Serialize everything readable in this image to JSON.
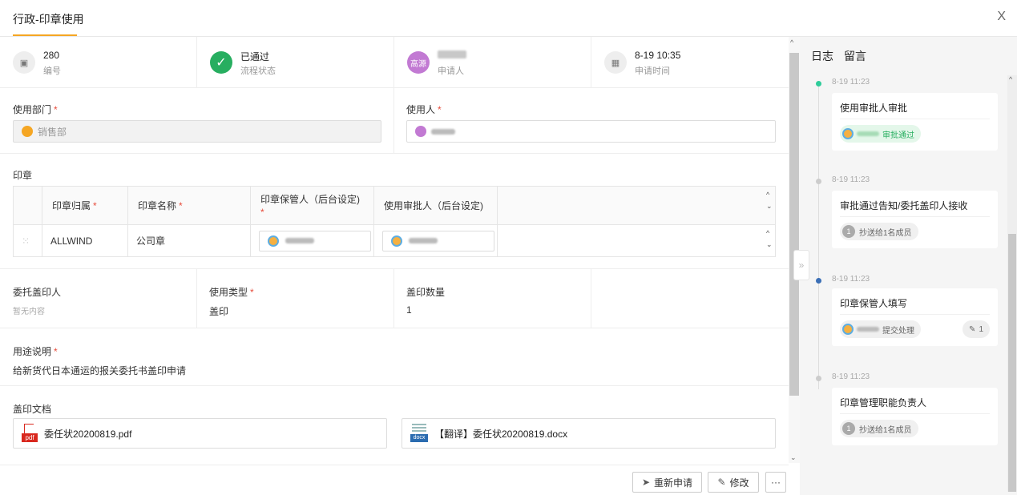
{
  "header": {
    "title": "行政-印章使用",
    "close_glyph": "X"
  },
  "info": {
    "number_value": "280",
    "number_label": "编号",
    "status_value": "已通过",
    "status_label": "流程状态",
    "applicant_avatar": "高源",
    "applicant_label": "申请人",
    "time_value": "8-19 10:35",
    "time_label": "申请时间"
  },
  "form": {
    "dept_label": "使用部门",
    "dept_value": "销售部",
    "user_label": "使用人",
    "seal_section": "印章",
    "seal_table": {
      "headers": [
        "印章归属",
        "印章名称",
        "印章保管人（后台设定)",
        "使用审批人（后台设定)"
      ],
      "row": {
        "owner": "ALLWIND",
        "name": "公司章"
      }
    },
    "delegate_label": "委托盖印人",
    "delegate_value": "暂无内容",
    "use_type_label": "使用类型",
    "use_type_value": "盖印",
    "count_label": "盖印数量",
    "count_value": "1",
    "purpose_label": "用途说明",
    "purpose_value": "给新货代日本通运的报关委托书盖印申请",
    "docs_label": "盖印文档",
    "docs": [
      {
        "name": "委任状20200819.pdf",
        "badge": "pdf"
      },
      {
        "name": "【翻译】委任状20200819.docx",
        "badge": "docx"
      }
    ]
  },
  "footer": {
    "resubmit_label": "重新申请",
    "edit_label": "修改",
    "more_label": "···"
  },
  "side": {
    "tabs": [
      "日志",
      "留言"
    ],
    "entries": [
      {
        "time": "8-19 11:23",
        "title": "使用审批人审批",
        "chip": "审批通过"
      },
      {
        "time": "8-19 11:23",
        "title": "审批通过告知/委托盖印人接收",
        "chip": "抄送给1名成员",
        "num": "1"
      },
      {
        "time": "8-19 11:23",
        "title": "印章保管人填写",
        "chip": "提交处理",
        "wrench_count": "1"
      },
      {
        "time": "8-19 11:23",
        "title": "印章管理职能负责人",
        "chip": "抄送给1名成员",
        "num": "1"
      }
    ]
  },
  "colors": {
    "accent": "#f5a623",
    "success": "#27ae60",
    "required": "#e74c3c"
  }
}
